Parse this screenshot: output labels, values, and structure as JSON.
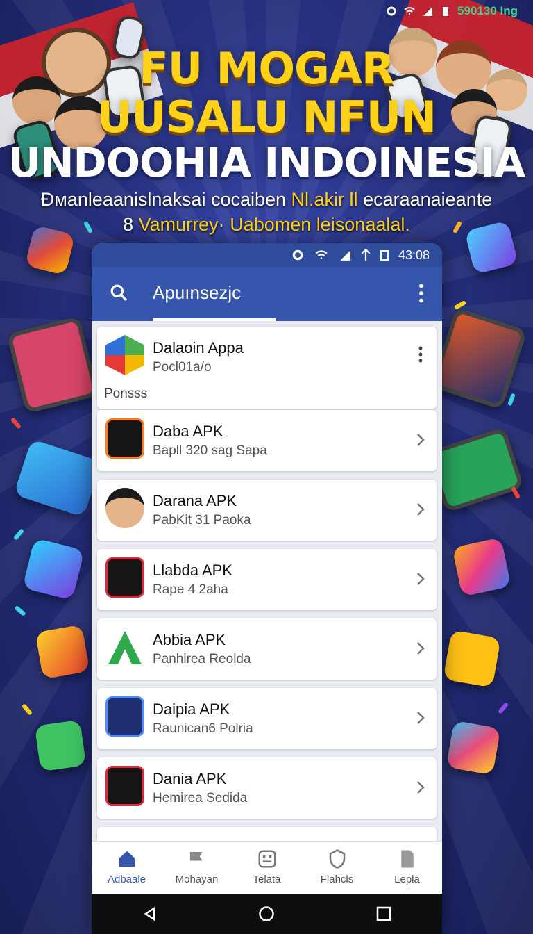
{
  "device_status": {
    "time": "590130 Ing"
  },
  "hero": {
    "line1": "FU MOGAR",
    "line2": "UUSALU NFUN",
    "line3": "UNDOOHIA INDOINESIA",
    "subtitle1_part1": "Đмanleaanislnaksai cocaiben",
    "subtitle1_part2": "Nl.akir ll",
    "subtitle1_part3": "ecaraanaieante",
    "subtitle2_part1": "8",
    "subtitle2_part2": "Vamurrey·",
    "subtitle2_part3": "Uabomen leisonaalal."
  },
  "phone": {
    "status_time": "43:08",
    "appbar": {
      "title": "Apuınsezjc"
    },
    "apps": [
      {
        "name": "Dalaoin Appa",
        "meta": "Pocl01a/o",
        "extra": "Ponsss",
        "action": "more"
      },
      {
        "name": "Daba APK",
        "meta": "Bapll 320 sag Sapa",
        "action": "chevron"
      },
      {
        "name": "Darana APK",
        "meta": "PabKit 31 Paoka",
        "action": "chevron"
      },
      {
        "name": "Llabda APK",
        "meta": "Rape 4 2aha",
        "action": "chevron"
      },
      {
        "name": "Abbia APK",
        "meta": "Panhirea Reolda",
        "action": "chevron"
      },
      {
        "name": "Daipia APK",
        "meta": "Raunican6 Polria",
        "action": "chevron"
      },
      {
        "name": "Dania APK",
        "meta": "Hemirea Sedida",
        "action": "chevron"
      }
    ],
    "bottom_nav": [
      {
        "label": "Adbaale",
        "icon": "home-icon",
        "active": true
      },
      {
        "label": "Mohayan",
        "icon": "flag-icon"
      },
      {
        "label": "Telata",
        "icon": "grid-icon"
      },
      {
        "label": "Flahcls",
        "icon": "shield-icon"
      },
      {
        "label": "Lepla",
        "icon": "file-icon"
      }
    ]
  },
  "colors": {
    "accent": "#3556ac",
    "title_yellow": "#ffd21a",
    "background": "#26307f"
  }
}
